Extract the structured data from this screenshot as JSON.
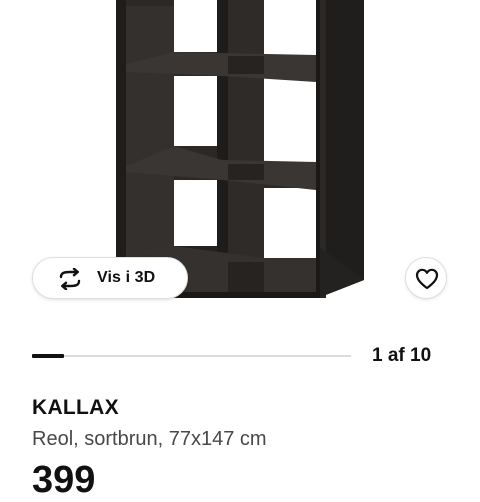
{
  "gallery": {
    "view_3d_label": "Vis i 3D",
    "favorite_icon": "heart-icon",
    "rotate_icon": "rotate-3d-icon",
    "progress_fraction": 0.1,
    "page_counter": "1 af 10"
  },
  "product": {
    "name": "KALLAX",
    "description": "Reol, sortbrun, 77x147 cm",
    "price_partial": "399"
  },
  "colors": {
    "shelf_front": "#2b2825",
    "shelf_shadow": "#1a1816",
    "text_primary": "#111111",
    "text_secondary": "#484848"
  }
}
